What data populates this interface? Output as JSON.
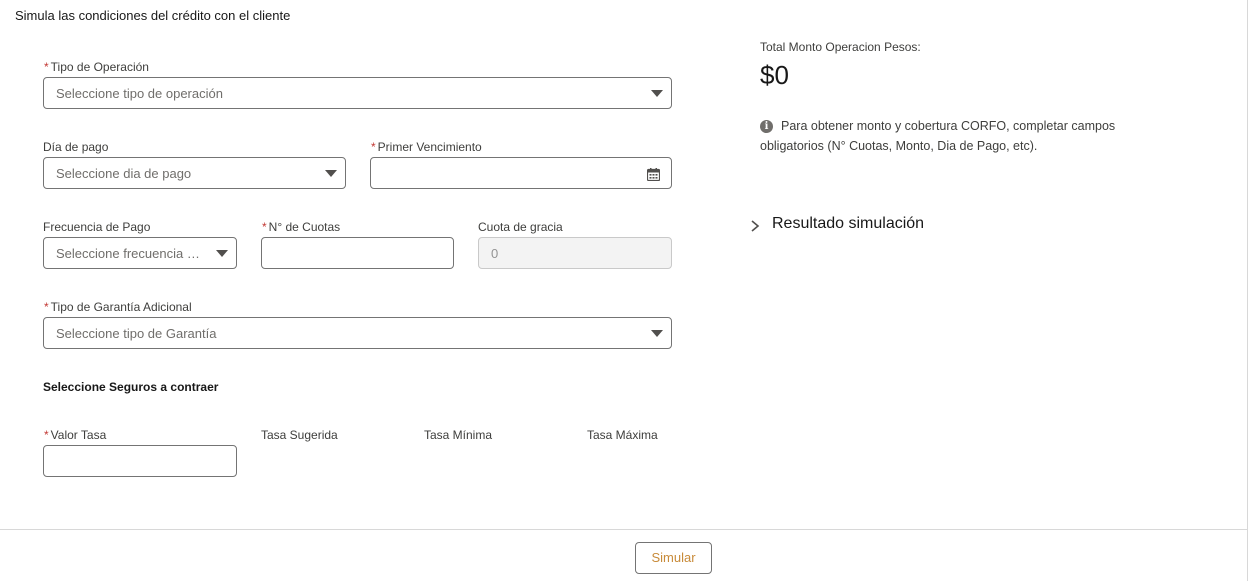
{
  "intro": "Simula las condiciones del crédito con el cliente",
  "form": {
    "tipo_operacion": {
      "label": "Tipo de Operación",
      "placeholder": "Seleccione tipo de operación"
    },
    "dia_pago": {
      "label": "Día de pago",
      "placeholder": "Seleccione dia de pago"
    },
    "primer_vencimiento": {
      "label": "Primer Vencimiento",
      "value": ""
    },
    "frecuencia_pago": {
      "label": "Frecuencia de Pago",
      "placeholder": "Seleccione frecuencia d..."
    },
    "n_cuotas": {
      "label": "N° de Cuotas",
      "value": ""
    },
    "cuota_gracia": {
      "label": "Cuota de gracia",
      "value": "0"
    },
    "tipo_garantia": {
      "label": "Tipo de Garantía Adicional",
      "placeholder": "Seleccione tipo de Garantía"
    },
    "seguros_title": "Seleccione Seguros a contraer",
    "valor_tasa": {
      "label": "Valor Tasa",
      "value": ""
    },
    "tasa_sugerida": "Tasa Sugerida",
    "tasa_minima": "Tasa Mínima",
    "tasa_maxima": "Tasa Máxima",
    "required_mark": "*"
  },
  "summary": {
    "total_label": "Total Monto Operacion Pesos:",
    "total_value": "$0",
    "info_icon_glyph": "i",
    "info_text": "Para obtener monto y cobertura CORFO, completar campos obligatorios (N° Cuotas, Monto, Dia de Pago, etc).",
    "accordion_label": "Resultado simulación"
  },
  "footer": {
    "simulate_label": "Simular"
  },
  "colors": {
    "required": "#c23934",
    "button_text": "#c88b3a",
    "border": "#747474"
  },
  "icons": {
    "dropdown": "chevron-down-icon",
    "calendar": "calendar-icon",
    "info": "info-icon",
    "accordion": "chevron-right-icon"
  }
}
